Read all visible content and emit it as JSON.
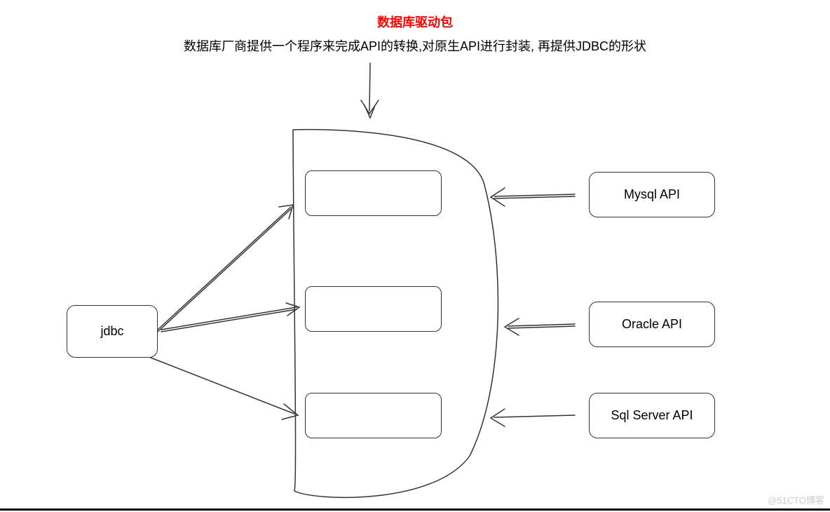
{
  "title": "数据库驱动包",
  "subtitle": "数据库厂商提供一个程序来完成API的转换,对原生API进行封装, 再提供JDBC的形状",
  "jdbc_label": "jdbc",
  "api_boxes": {
    "mysql": "Mysql API",
    "oracle": "Oracle API",
    "sqlserver": "Sql Server API"
  },
  "watermark": "@51CTO博客"
}
